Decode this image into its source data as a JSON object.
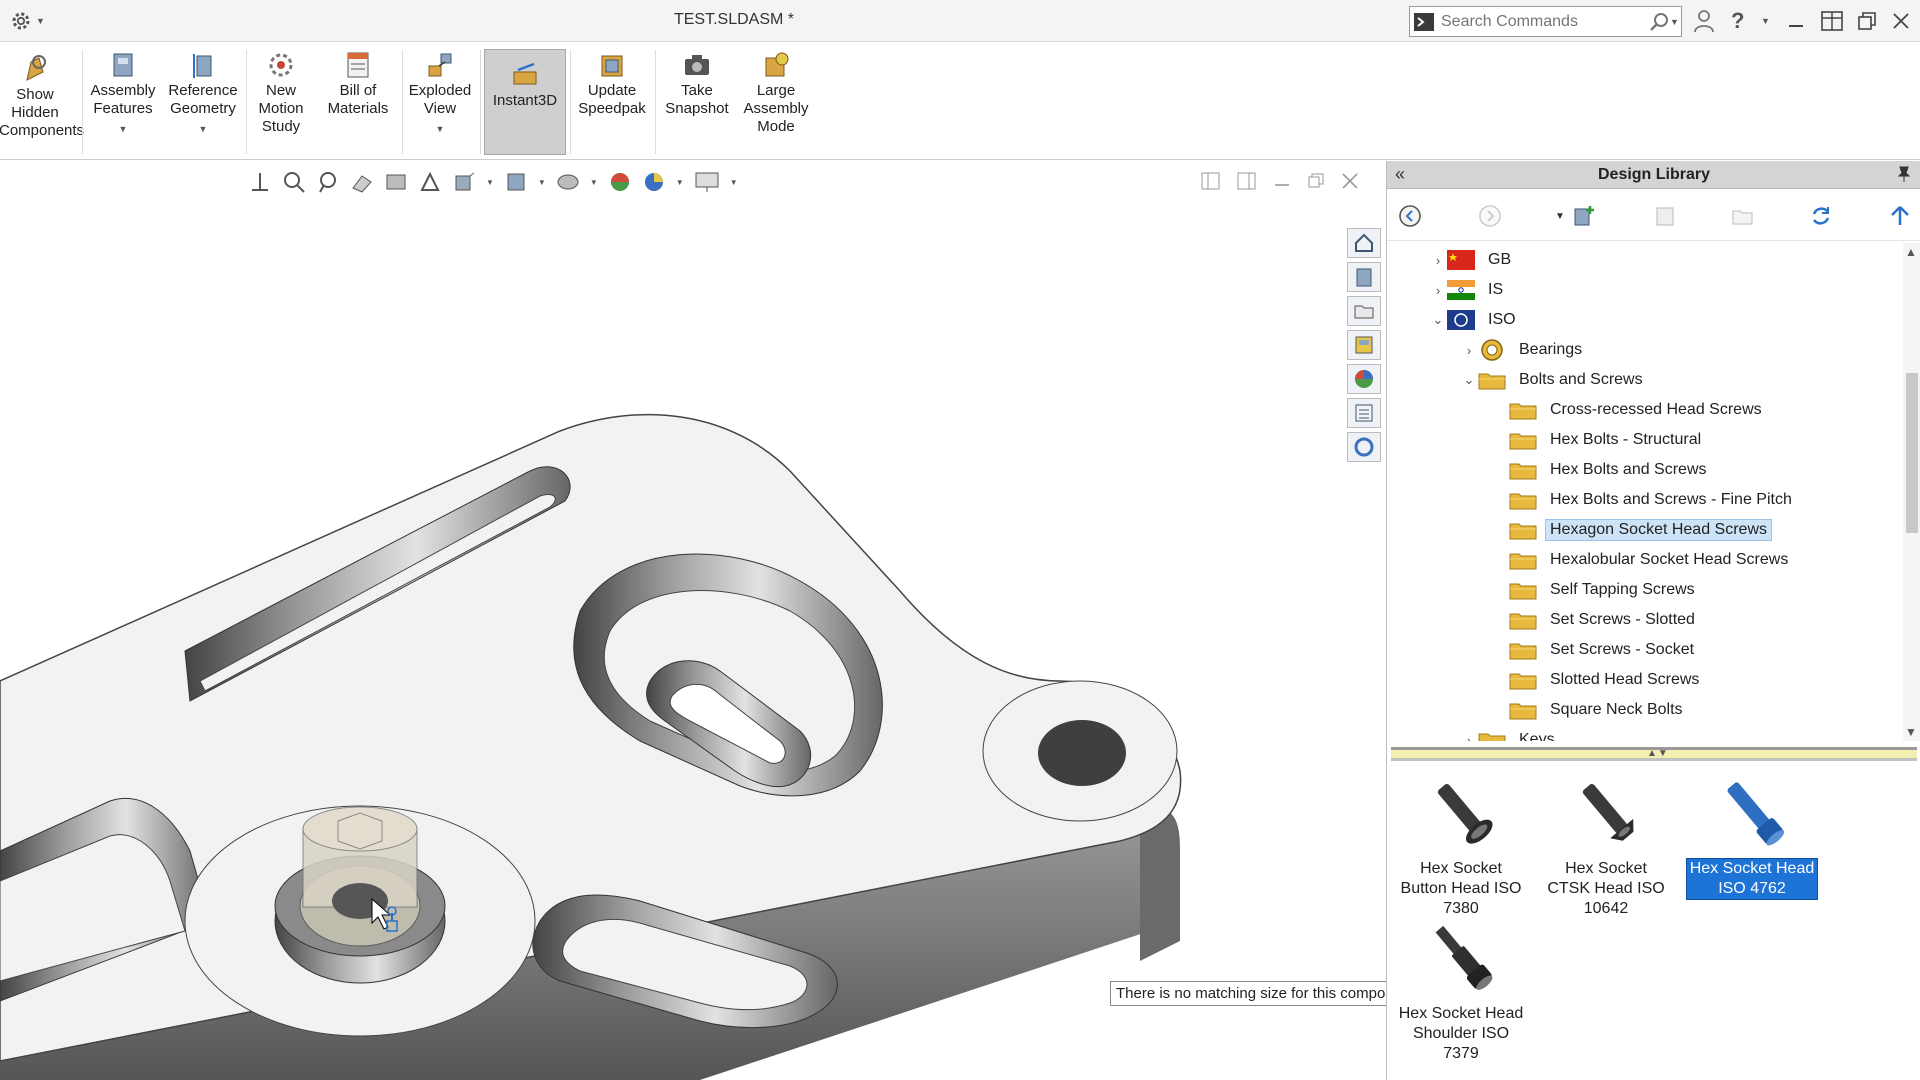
{
  "window": {
    "title": "TEST.SLDASM *",
    "search_placeholder": "Search Commands"
  },
  "ribbon": {
    "buttons": [
      {
        "label": "Show Hidden Components",
        "icon": "show-hidden-icon"
      },
      {
        "label": "Assembly Features",
        "icon": "assembly-features-icon",
        "dropdown": true
      },
      {
        "label": "Reference Geometry",
        "icon": "reference-geometry-icon",
        "dropdown": true
      },
      {
        "label": "New Motion Study",
        "icon": "motion-study-icon"
      },
      {
        "label": "Bill of Materials",
        "icon": "bom-icon"
      },
      {
        "label": "Exploded View",
        "icon": "exploded-view-icon",
        "dropdown": true
      },
      {
        "label": "Instant3D",
        "icon": "instant3d-icon",
        "active": true
      },
      {
        "label": "Update Speedpak",
        "icon": "speedpak-icon"
      },
      {
        "label": "Take Snapshot",
        "icon": "camera-icon"
      },
      {
        "label": "Large Assembly Mode",
        "icon": "large-assembly-icon"
      }
    ]
  },
  "viewport": {
    "tooltip": "There is no matching size for this component."
  },
  "design_library": {
    "title": "Design Library",
    "tree": [
      {
        "label": "GB",
        "level": 0,
        "state": "collapsed",
        "icon": "flag-cn-icon"
      },
      {
        "label": "IS",
        "level": 0,
        "state": "collapsed",
        "icon": "flag-in-icon"
      },
      {
        "label": "ISO",
        "level": 0,
        "state": "expanded",
        "icon": "iso-icon"
      },
      {
        "label": "Bearings",
        "level": 1,
        "state": "collapsed",
        "icon": "bearing-icon"
      },
      {
        "label": "Bolts and Screws",
        "level": 1,
        "state": "expanded",
        "icon": "folder-icon"
      },
      {
        "label": "Cross-recessed Head Screws",
        "level": 2,
        "icon": "folder-icon"
      },
      {
        "label": "Hex Bolts - Structural",
        "level": 2,
        "icon": "folder-icon"
      },
      {
        "label": "Hex Bolts and Screws",
        "level": 2,
        "icon": "folder-icon"
      },
      {
        "label": "Hex Bolts and Screws - Fine Pitch",
        "level": 2,
        "icon": "folder-icon"
      },
      {
        "label": "Hexagon Socket Head Screws",
        "level": 2,
        "icon": "folder-icon",
        "selected": true
      },
      {
        "label": "Hexalobular Socket Head Screws",
        "level": 2,
        "icon": "folder-icon"
      },
      {
        "label": "Self Tapping Screws",
        "level": 2,
        "icon": "folder-icon"
      },
      {
        "label": "Set Screws - Slotted",
        "level": 2,
        "icon": "folder-icon"
      },
      {
        "label": "Set Screws - Socket",
        "level": 2,
        "icon": "folder-icon"
      },
      {
        "label": "Slotted Head Screws",
        "level": 2,
        "icon": "folder-icon"
      },
      {
        "label": "Square Neck Bolts",
        "level": 2,
        "icon": "folder-icon"
      },
      {
        "label": "Keys",
        "level": 1,
        "state": "collapsed",
        "icon": "folder-icon"
      }
    ],
    "components": [
      {
        "label": "Hex Socket Button Head ISO 7380",
        "color": "#3a3a3a"
      },
      {
        "label": "Hex Socket CTSK Head ISO 10642",
        "color": "#3a3a3a"
      },
      {
        "label": "Hex Socket Head ISO 4762",
        "color": "#2f6fc2",
        "selected": true
      },
      {
        "label": "Hex Socket Head Shoulder ISO 7379",
        "color": "#3a3a3a"
      }
    ]
  },
  "colors": {
    "selection_blue": "#1e73d6",
    "tree_selection": "#cde3f7",
    "folder_yellow": "#e8b93c"
  }
}
